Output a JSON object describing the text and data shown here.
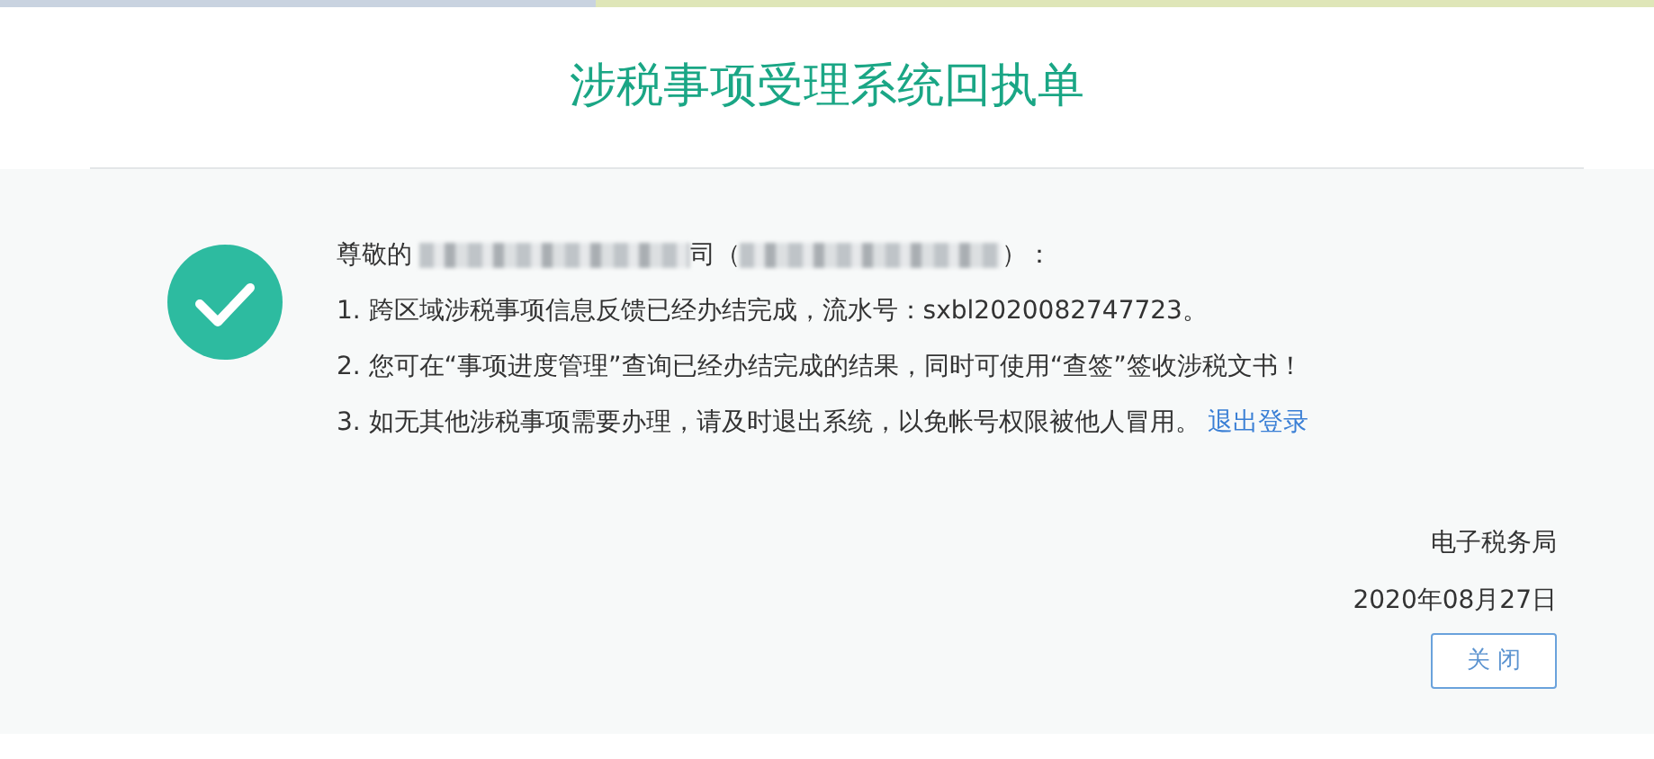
{
  "title": "涉税事项受理系统回执单",
  "greeting": {
    "prefix": "尊敬的",
    "middle": "司（",
    "suffix": "）："
  },
  "lines": [
    {
      "text": "1. 跨区域涉税事项信息反馈已经办结完成，流水号：sxbl2020082747723。"
    },
    {
      "text": "2. 您可在“事项进度管理”查询已经办结完成的结果，同时可使用“查签”签收涉税文书！"
    },
    {
      "text": "3. 如无其他涉税事项需要办理，请及时退出系统，以免帐号权限被他人冒用。",
      "link": "退出登录"
    }
  ],
  "issuer": "电子税务局",
  "date": "2020年08月27日",
  "close_button": "关 闭"
}
